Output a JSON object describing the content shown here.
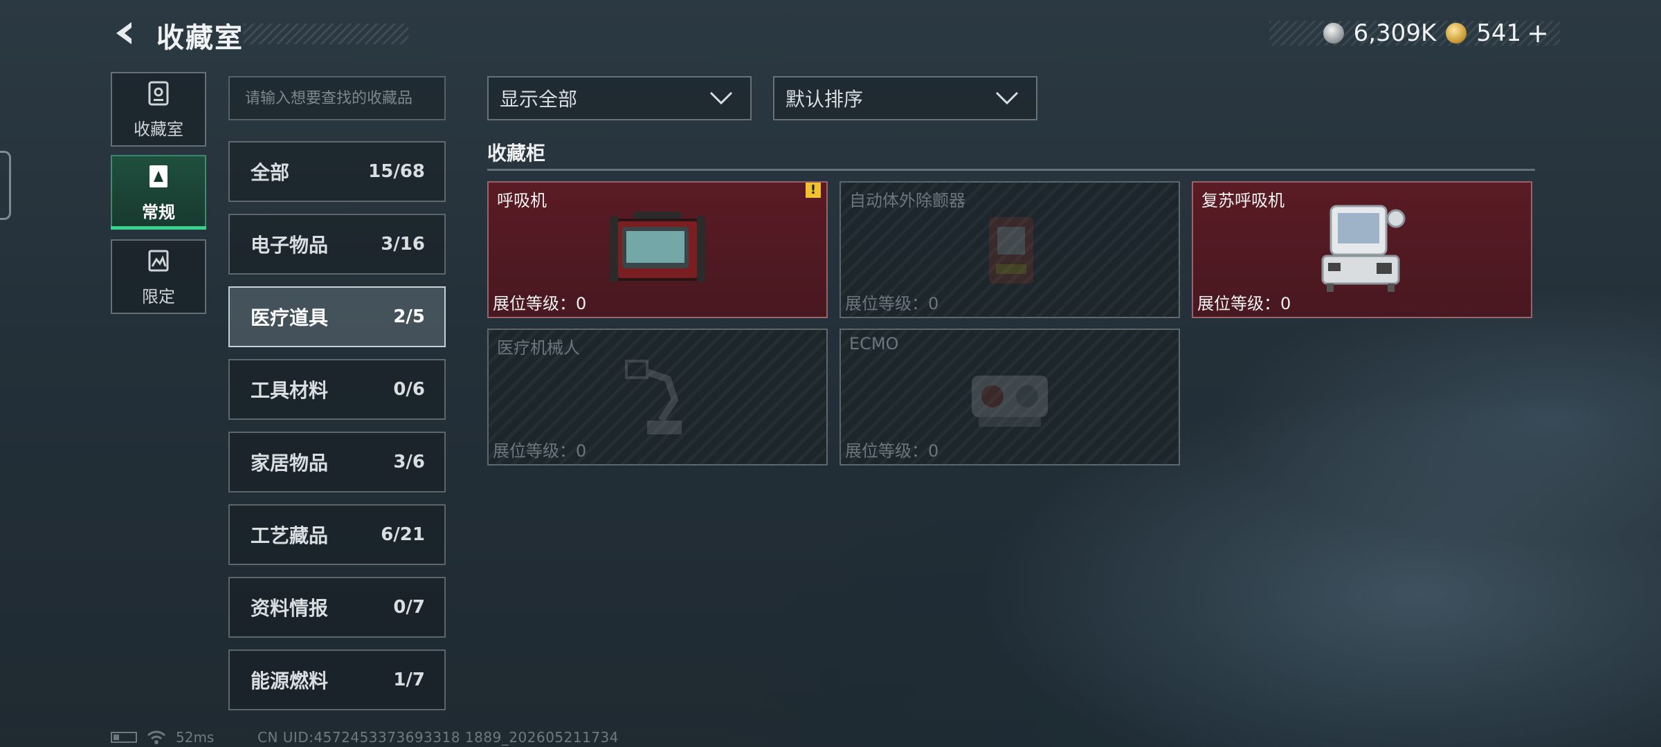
{
  "header": {
    "title": "收藏室",
    "back_icon": "back-arrow-icon",
    "currency": [
      {
        "icon": "silver-coin-icon",
        "value": "6,309K"
      },
      {
        "icon": "gold-coin-icon",
        "value": "541"
      }
    ],
    "plus_label": "+"
  },
  "nav": {
    "items": [
      {
        "label": "收藏室",
        "icon": "cabinet-icon",
        "active": false
      },
      {
        "label": "常规",
        "icon": "card-icon",
        "active": true
      },
      {
        "label": "限定",
        "icon": "limited-icon",
        "active": false
      }
    ],
    "accent_color": "#36d28e"
  },
  "search": {
    "placeholder": "请输入想要查找的收藏品",
    "value": ""
  },
  "categories": [
    {
      "name": "全部",
      "count": "15/68",
      "active": false
    },
    {
      "name": "电子物品",
      "count": "3/16",
      "active": false
    },
    {
      "name": "医疗道具",
      "count": "2/5",
      "active": true
    },
    {
      "name": "工具材料",
      "count": "0/6",
      "active": false
    },
    {
      "name": "家居物品",
      "count": "3/6",
      "active": false
    },
    {
      "name": "工艺藏品",
      "count": "6/21",
      "active": false
    },
    {
      "name": "资料情报",
      "count": "0/7",
      "active": false
    },
    {
      "name": "能源燃料",
      "count": "1/7",
      "active": false
    }
  ],
  "filters": {
    "display": {
      "selected": "显示全部",
      "icon": "chevron-down-icon"
    },
    "sort": {
      "selected": "默认排序",
      "icon": "chevron-down-icon"
    }
  },
  "cabinet": {
    "title": "收藏柜",
    "items": [
      {
        "name": "呼吸机",
        "level_label": "展位等级：",
        "level": "0",
        "owned": true,
        "warning": "!",
        "image": "ventilator-image"
      },
      {
        "name": "自动体外除颤器",
        "level_label": "展位等级：",
        "level": "0",
        "owned": false,
        "image": "defibrillator-image"
      },
      {
        "name": "复苏呼吸机",
        "level_label": "展位等级：",
        "level": "0",
        "owned": true,
        "image": "resuscitation-ventilator-image"
      },
      {
        "name": "医疗机械人",
        "level_label": "展位等级：",
        "level": "0",
        "owned": false,
        "image": "medical-robot-image"
      },
      {
        "name": "ECMO",
        "level_label": "展位等级：",
        "level": "0",
        "owned": false,
        "image": "ecmo-image"
      }
    ],
    "owned_color": "#5a1b24"
  },
  "status": {
    "ping": "52ms",
    "uid": "CN UID:4572453373693318 1889_202605211734"
  }
}
